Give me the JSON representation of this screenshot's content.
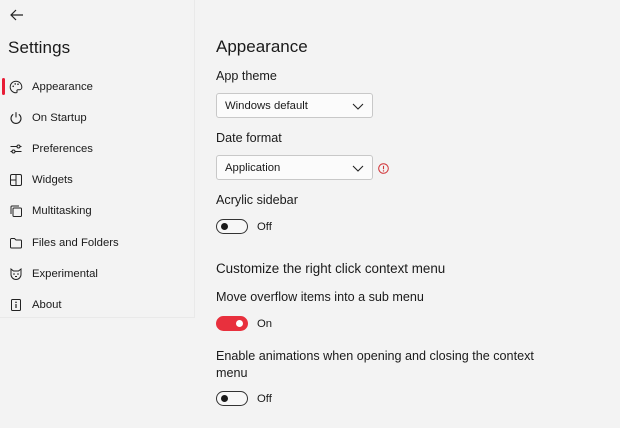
{
  "sidebar": {
    "title": "Settings",
    "items": [
      {
        "label": "Appearance",
        "icon": "palette-icon"
      },
      {
        "label": "On Startup",
        "icon": "power-icon"
      },
      {
        "label": "Preferences",
        "icon": "sliders-icon"
      },
      {
        "label": "Widgets",
        "icon": "widgets-icon"
      },
      {
        "label": "Multitasking",
        "icon": "multitasking-icon"
      },
      {
        "label": "Files and Folders",
        "icon": "folder-icon"
      },
      {
        "label": "Experimental",
        "icon": "experimental-icon"
      },
      {
        "label": "About",
        "icon": "info-icon"
      }
    ]
  },
  "main": {
    "title": "Appearance",
    "app_theme": {
      "label": "App theme",
      "value": "Windows default"
    },
    "date_format": {
      "label": "Date format",
      "value": "Application"
    },
    "acrylic": {
      "label": "Acrylic sidebar",
      "state": "Off"
    },
    "context_section": "Customize the right click context menu",
    "overflow": {
      "label": "Move overflow items into a sub menu",
      "state": "On"
    },
    "animations": {
      "label": "Enable animations when opening and closing the context menu",
      "state": "Off"
    }
  },
  "colors": {
    "accent": "#e8303d",
    "warning": "#d13438"
  }
}
